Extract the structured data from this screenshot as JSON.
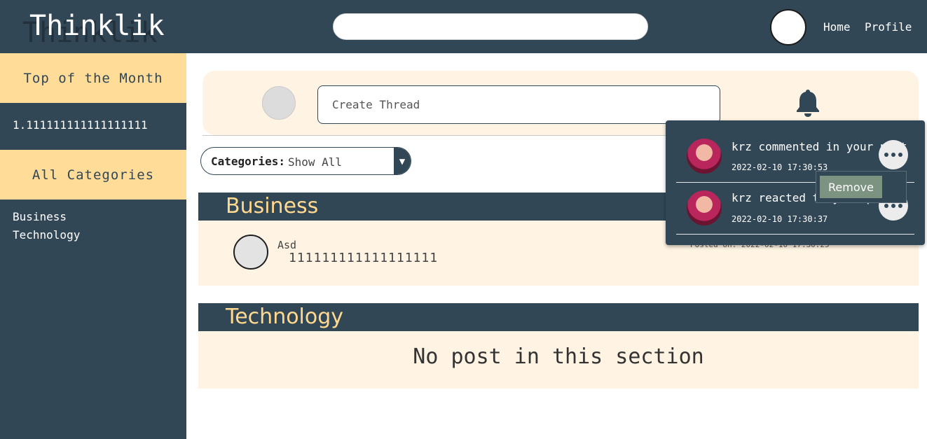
{
  "header": {
    "logo": "Thinklik",
    "nav": {
      "home": "Home",
      "profile": "Profile"
    }
  },
  "sidebar": {
    "top_title": "Top of the Month",
    "top_items": [
      "1.111111111111111111"
    ],
    "categories_title": "All Categories",
    "categories": [
      "Business",
      "Technology"
    ]
  },
  "create": {
    "placeholder": "Create Thread"
  },
  "filter": {
    "label": "Categories:",
    "value": "Show All",
    "arrow": "▼"
  },
  "sections": [
    {
      "title": "Business",
      "posts": [
        {
          "author": "Asd",
          "text": "111111111111111111",
          "posted": "Posted on: 2022-02-10 17:30:25"
        }
      ]
    },
    {
      "title": "Technology",
      "empty_message": "No post in this section"
    }
  ],
  "notifications": [
    {
      "text": "krz commented in your post",
      "time": "2022-02-10 17:30:53"
    },
    {
      "text": "krz reacted to your post",
      "time": "2022-02-10 17:30:37"
    }
  ],
  "notification_menu": {
    "remove": "Remove"
  },
  "colors": {
    "primary": "#324756",
    "accent": "#ffdc98",
    "panel": "#fff4e3",
    "remove": "#7b9380"
  },
  "icons": [
    "bell-icon",
    "more-icon",
    "dropdown-arrow-icon"
  ]
}
